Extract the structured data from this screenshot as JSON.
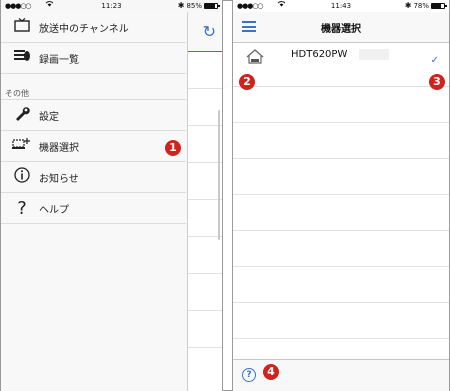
{
  "left_phone": {
    "status": {
      "signal": "●●●○○",
      "wifi": "wifi-icon",
      "time": "11:23",
      "bluetooth": "bluetooth-icon",
      "battery_text": "85%",
      "battery_level": 0.85
    },
    "menu_top": [
      {
        "icon": "tv-icon",
        "label": "放送中のチャンネル"
      },
      {
        "icon": "recordings-icon",
        "label": "録画一覧"
      }
    ],
    "section_label": "その他",
    "menu_other": [
      {
        "icon": "wrench-icon",
        "label": "設定"
      },
      {
        "icon": "device-select-icon",
        "label": "機器選択"
      },
      {
        "icon": "info-icon",
        "label": "お知らせ"
      },
      {
        "icon": "question-icon",
        "label": "ヘルプ"
      }
    ],
    "refresh_icon": "refresh-icon"
  },
  "right_phone": {
    "status": {
      "signal": "●●●○○",
      "wifi": "wifi-icon",
      "time": "11:43",
      "bluetooth": "bluetooth-icon",
      "battery_text": "78%",
      "battery_level": 0.78
    },
    "title": "機器選択",
    "devices": [
      {
        "name": "HDT620PW",
        "selected": true
      }
    ],
    "help_icon": "help-circle-icon"
  },
  "annotations": [
    "1",
    "2",
    "3",
    "4"
  ],
  "colors": {
    "accent": "#3a73c8",
    "badge": "#d2221d"
  }
}
